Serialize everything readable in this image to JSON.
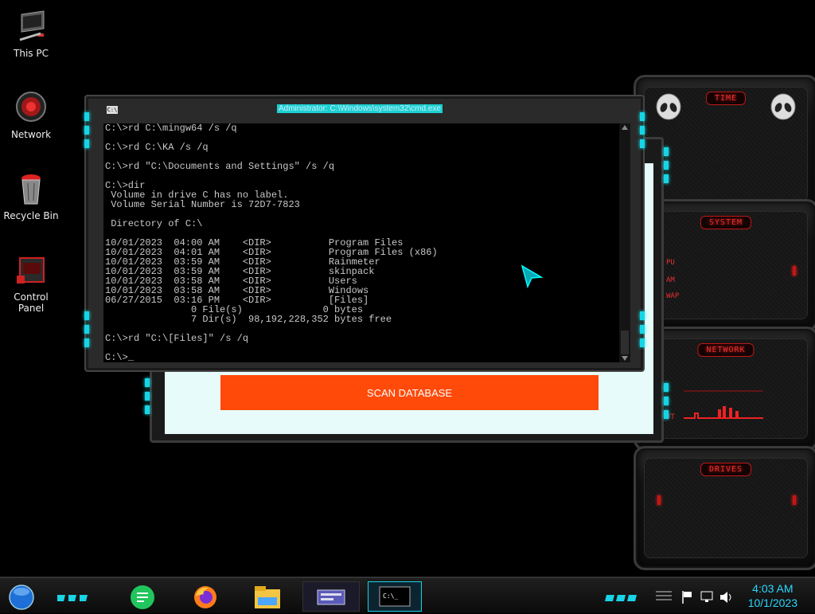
{
  "desktop_icons": [
    {
      "label": "This PC",
      "icon": "computer-icon"
    },
    {
      "label": "Network",
      "icon": "network-icon"
    },
    {
      "label": "Recycle Bin",
      "icon": "recycle-bin-icon"
    },
    {
      "label": "Control Panel",
      "icon": "control-panel-icon"
    }
  ],
  "cmd": {
    "title": "Administrator: C:\\Windows\\system32\\cmd.exe",
    "lines": [
      "C:\\>rd C:\\mingw64 /s /q",
      "",
      "C:\\>rd C:\\KA /s /q",
      "",
      "C:\\>rd \"C:\\Documents and Settings\" /s /q",
      "",
      "C:\\>dir",
      " Volume in drive C has no label.",
      " Volume Serial Number is 72D7-7823",
      "",
      " Directory of C:\\",
      "",
      "10/01/2023  04:00 AM    <DIR>          Program Files",
      "10/01/2023  04:01 AM    <DIR>          Program Files (x86)",
      "10/01/2023  03:59 AM    <DIR>          Rainmeter",
      "10/01/2023  03:59 AM    <DIR>          skinpack",
      "10/01/2023  03:58 AM    <DIR>          Users",
      "10/01/2023  03:58 AM    <DIR>          Windows",
      "06/27/2015  03:16 PM    <DIR>          [Files]",
      "               0 File(s)              0 bytes",
      "               7 Dir(s)  98,192,228,352 bytes free",
      "",
      "C:\\>rd \"C:\\[Files]\" /s /q",
      "",
      "C:\\>_"
    ]
  },
  "scan_window": {
    "button_label": "SCAN DATABASE"
  },
  "widgets": {
    "time": "TIME",
    "system": "SYSTEM",
    "system_rows": [
      "PU",
      "AM",
      "WAP"
    ],
    "network": "NETWORK",
    "network_rows": [
      "JT"
    ],
    "drives": "DRIVES"
  },
  "taskbar": {
    "items": [
      "start-orb-icon",
      "notes-app-icon",
      "firefox-icon",
      "file-explorer-icon",
      "control-panel-taskbar-icon",
      "cmd-taskbar-icon"
    ],
    "time": "4:03 AM",
    "date": "10/1/2023"
  },
  "colors": {
    "accent_cyan": "#17d4e6",
    "accent_red": "#e53030",
    "scan_button": "#ff4a0a",
    "scan_client": "#e6fbfa"
  }
}
